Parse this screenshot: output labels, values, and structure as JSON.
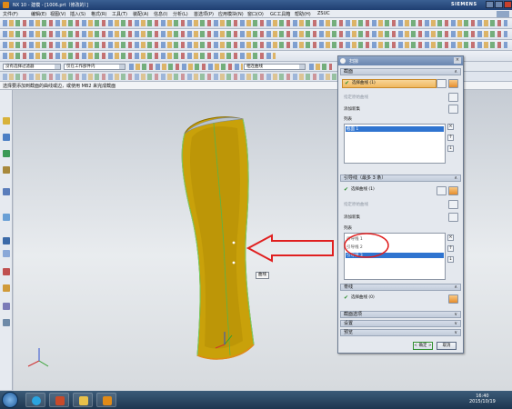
{
  "app": {
    "title": "NX 10 - 建模 - [1006.prt（修改的）]",
    "brand": "SIEMENS"
  },
  "menu": [
    "文件(F)",
    "编辑(E)",
    "视图(V)",
    "插入(S)",
    "格式(R)",
    "工具(T)",
    "装配(A)",
    "信息(I)",
    "分析(L)",
    "首选项(P)",
    "应用模块(N)",
    "窗口(O)",
    "GC工具箱",
    "帮助(H)",
    "ZSUC"
  ],
  "filterbar": {
    "type_filter": "没有选择过滤器",
    "scope_filter": "仅在工作部件内",
    "third_filter": "相连曲线"
  },
  "cue": "选择要添加到截面的曲线或边，或使用 MB2 来完成截面",
  "tooltip": "曲线",
  "dialog": {
    "title": "扫掠",
    "sections": {
      "section": {
        "header": "截面",
        "select_label": "选择曲线 (1)",
        "specify_origin": "指定原始曲线",
        "add_new": "添加新集",
        "list_header": "列表",
        "items": [
          "截面 1"
        ]
      },
      "guides": {
        "header": "引导线（最多 3 条）",
        "select_label": "选择曲线 (1)",
        "specify_origin": "指定原始曲线",
        "add_new": "添加新集",
        "list_header": "列表",
        "items": [
          "引导线 1",
          "引导线 2",
          "引导线 3"
        ]
      },
      "spine": {
        "header": "脊线",
        "select_label": "选择曲线 (0)"
      },
      "collapsed": [
        "截面选项",
        "设置",
        "预览"
      ]
    },
    "buttons": {
      "ok": "< 确定 >",
      "cancel": "取消"
    }
  },
  "taskbar": {
    "time": "16:40",
    "date": "2015/10/19"
  },
  "colors": {
    "surface_main": "#c9a10a",
    "highlight_list": "#2f74d0",
    "annotation_red": "#e02020",
    "selection_row": "#f0b860"
  }
}
